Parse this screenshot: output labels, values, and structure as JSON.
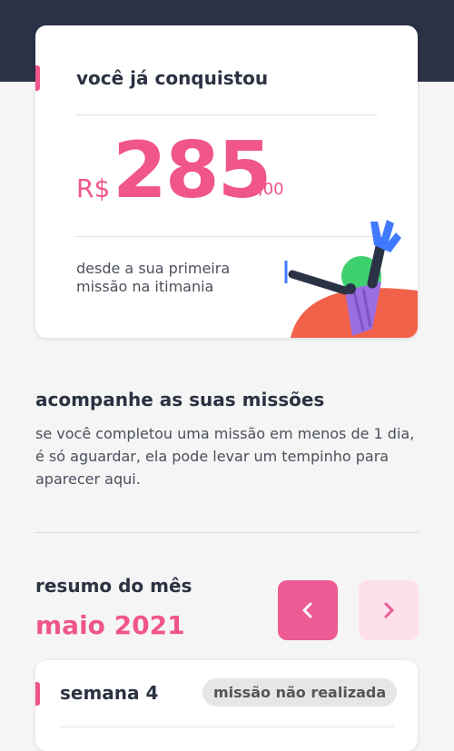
{
  "summary_card": {
    "title": "você já conquistou",
    "currency": "R$",
    "amount_integer": "285",
    "amount_decimal": ",00",
    "subtitle": "desde a sua primeira missão na itimania"
  },
  "missions_section": {
    "title": "acompanhe as suas missões",
    "description": "se você completou uma missão em menos de 1 dia, é só aguardar, ela pode levar um tempinho para aparecer aqui."
  },
  "month_summary": {
    "label": "resumo do mês",
    "month": "maio 2021",
    "prev_icon": "chevron-left-icon",
    "next_icon": "chevron-right-icon"
  },
  "week_card": {
    "title": "semana 4",
    "status": "missão não realizada"
  },
  "colors": {
    "accent": "#f0558c",
    "header_bg": "#2b3246",
    "text_dark": "#2b3242",
    "nav_prev_bg": "#ec5b93",
    "nav_next_bg": "#fde0ec"
  }
}
